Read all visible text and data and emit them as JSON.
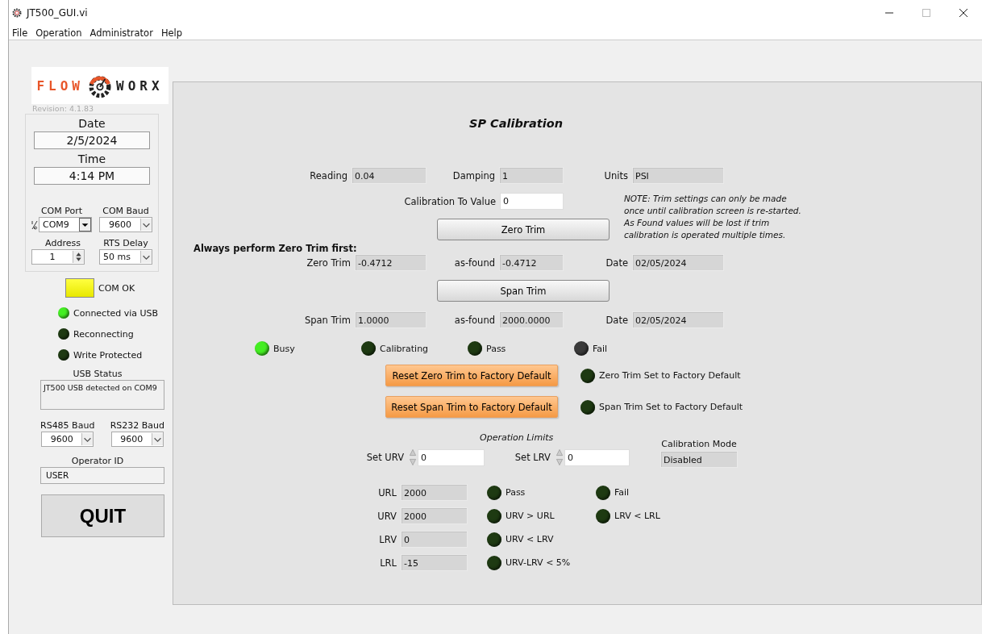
{
  "window": {
    "title": "JT500_GUI.vi"
  },
  "menu": [
    {
      "label": "File"
    },
    {
      "label": "Operation"
    },
    {
      "label": "Administrator"
    },
    {
      "label": "Help"
    }
  ],
  "sidebar": {
    "logo": {
      "left": "FLOW",
      "right": "WORX"
    },
    "revision": "Revision: 4.1.83",
    "date": {
      "label": "Date",
      "value": "2/5/2024"
    },
    "time": {
      "label": "Time",
      "value": "4:14 PM"
    },
    "com_port": {
      "label": "COM Port",
      "value": "COM9"
    },
    "com_baud": {
      "label": "COM Baud",
      "value": "9600"
    },
    "address": {
      "label": "Address",
      "value": "1"
    },
    "rts_delay": {
      "label": "RTS Delay",
      "value": "50 ms"
    },
    "com_ok": {
      "label": "COM OK",
      "on": true
    },
    "indicators": [
      {
        "label": "Connected via USB",
        "on": true
      },
      {
        "label": "Reconnecting",
        "on": false
      },
      {
        "label": "Write Protected",
        "on": false
      }
    ],
    "usb_status": {
      "label": "USB Status",
      "value": "JT500 USB detected on COM9"
    },
    "rs485_baud": {
      "label": "RS485 Baud",
      "value": "9600"
    },
    "rs232_baud": {
      "label": "RS232 Baud",
      "value": "9600"
    },
    "operator_id": {
      "label": "Operator ID",
      "value": "USER"
    },
    "quit_button": "QUIT"
  },
  "panel": {
    "title": "SP Calibration",
    "reading": {
      "label": "Reading",
      "value": "0.04"
    },
    "damping": {
      "label": "Damping",
      "value": "1"
    },
    "units": {
      "label": "Units",
      "value": "PSI"
    },
    "calibration_to_value": {
      "label": "Calibration To Value",
      "value": "0"
    },
    "note": [
      "NOTE: Trim settings can only be made",
      "once until calibration screen is re-started.",
      "As Found values will be lost if trim",
      "calibration is operated multiple times."
    ],
    "zero_trim_button": "Zero Trim",
    "warning": "Always perform Zero Trim first:",
    "zero_trim": {
      "label": "Zero Trim",
      "value": "-0.4712",
      "as_found_label": "as-found",
      "as_found": "-0.4712",
      "date_label": "Date",
      "date": "02/05/2024"
    },
    "span_trim_button": "Span Trim",
    "span_trim": {
      "label": "Span Trim",
      "value": "1.0000",
      "as_found_label": "as-found",
      "as_found": "2000.0000",
      "date_label": "Date",
      "date": "02/05/2024"
    },
    "status": [
      {
        "label": "Busy",
        "color": "#44ee22"
      },
      {
        "label": "Calibrating",
        "color": "#1e3a12"
      },
      {
        "label": "Pass",
        "color": "#1e3a12"
      },
      {
        "label": "Fail",
        "color": "#3a3a3a"
      }
    ],
    "resets": [
      {
        "button": "Reset Zero Trim to Factory Default",
        "indicator": "Zero Trim Set to Factory Default",
        "on": false
      },
      {
        "button": "Reset Span Trim to Factory Default",
        "indicator": "Span Trim Set to Factory Default",
        "on": false
      }
    ],
    "operation_limits": {
      "title": "Operation Limits",
      "set_urv": {
        "label": "Set URV",
        "value": "0"
      },
      "set_lrv": {
        "label": "Set LRV",
        "value": "0"
      }
    },
    "calibration_mode": {
      "label": "Calibration Mode",
      "value": "Disabled"
    },
    "limits": [
      {
        "label": "URL",
        "value": "2000",
        "checks": [
          {
            "label": "Pass",
            "on": false
          },
          {
            "label": "Fail",
            "on": false
          }
        ]
      },
      {
        "label": "URV",
        "value": "2000",
        "checks": [
          {
            "label": "URV > URL",
            "on": false
          },
          {
            "label": "LRV < LRL",
            "on": false
          }
        ]
      },
      {
        "label": "LRV",
        "value": "0",
        "checks": [
          {
            "label": "URV < LRV",
            "on": false
          }
        ]
      },
      {
        "label": "LRL",
        "value": "-15",
        "checks": [
          {
            "label": "URV-LRV < 5%",
            "on": false
          }
        ]
      }
    ]
  }
}
